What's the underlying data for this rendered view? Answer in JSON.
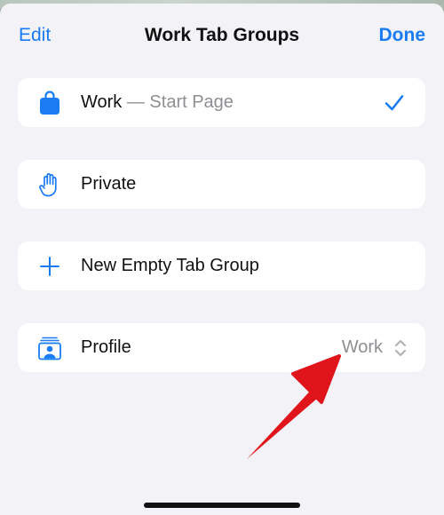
{
  "nav": {
    "edit_label": "Edit",
    "title": "Work Tab Groups",
    "done_label": "Done"
  },
  "rows": [
    {
      "icon": "shopping-bag-icon",
      "label": "Work",
      "sublabel": " — Start Page",
      "selected": true
    },
    {
      "icon": "hand-raised-icon",
      "label": "Private"
    },
    {
      "icon": "plus-icon",
      "label": "New Empty Tab Group"
    },
    {
      "icon": "profile-card-icon",
      "label": "Profile",
      "value": "Work",
      "accessory": "chevron-up-down-icon"
    }
  ],
  "colors": {
    "accent": "#1a7cf2",
    "background": "#f2f2f7",
    "row": "#ffffff",
    "secondary_text": "#8e8e93",
    "annotation_arrow": "#e0141b"
  }
}
